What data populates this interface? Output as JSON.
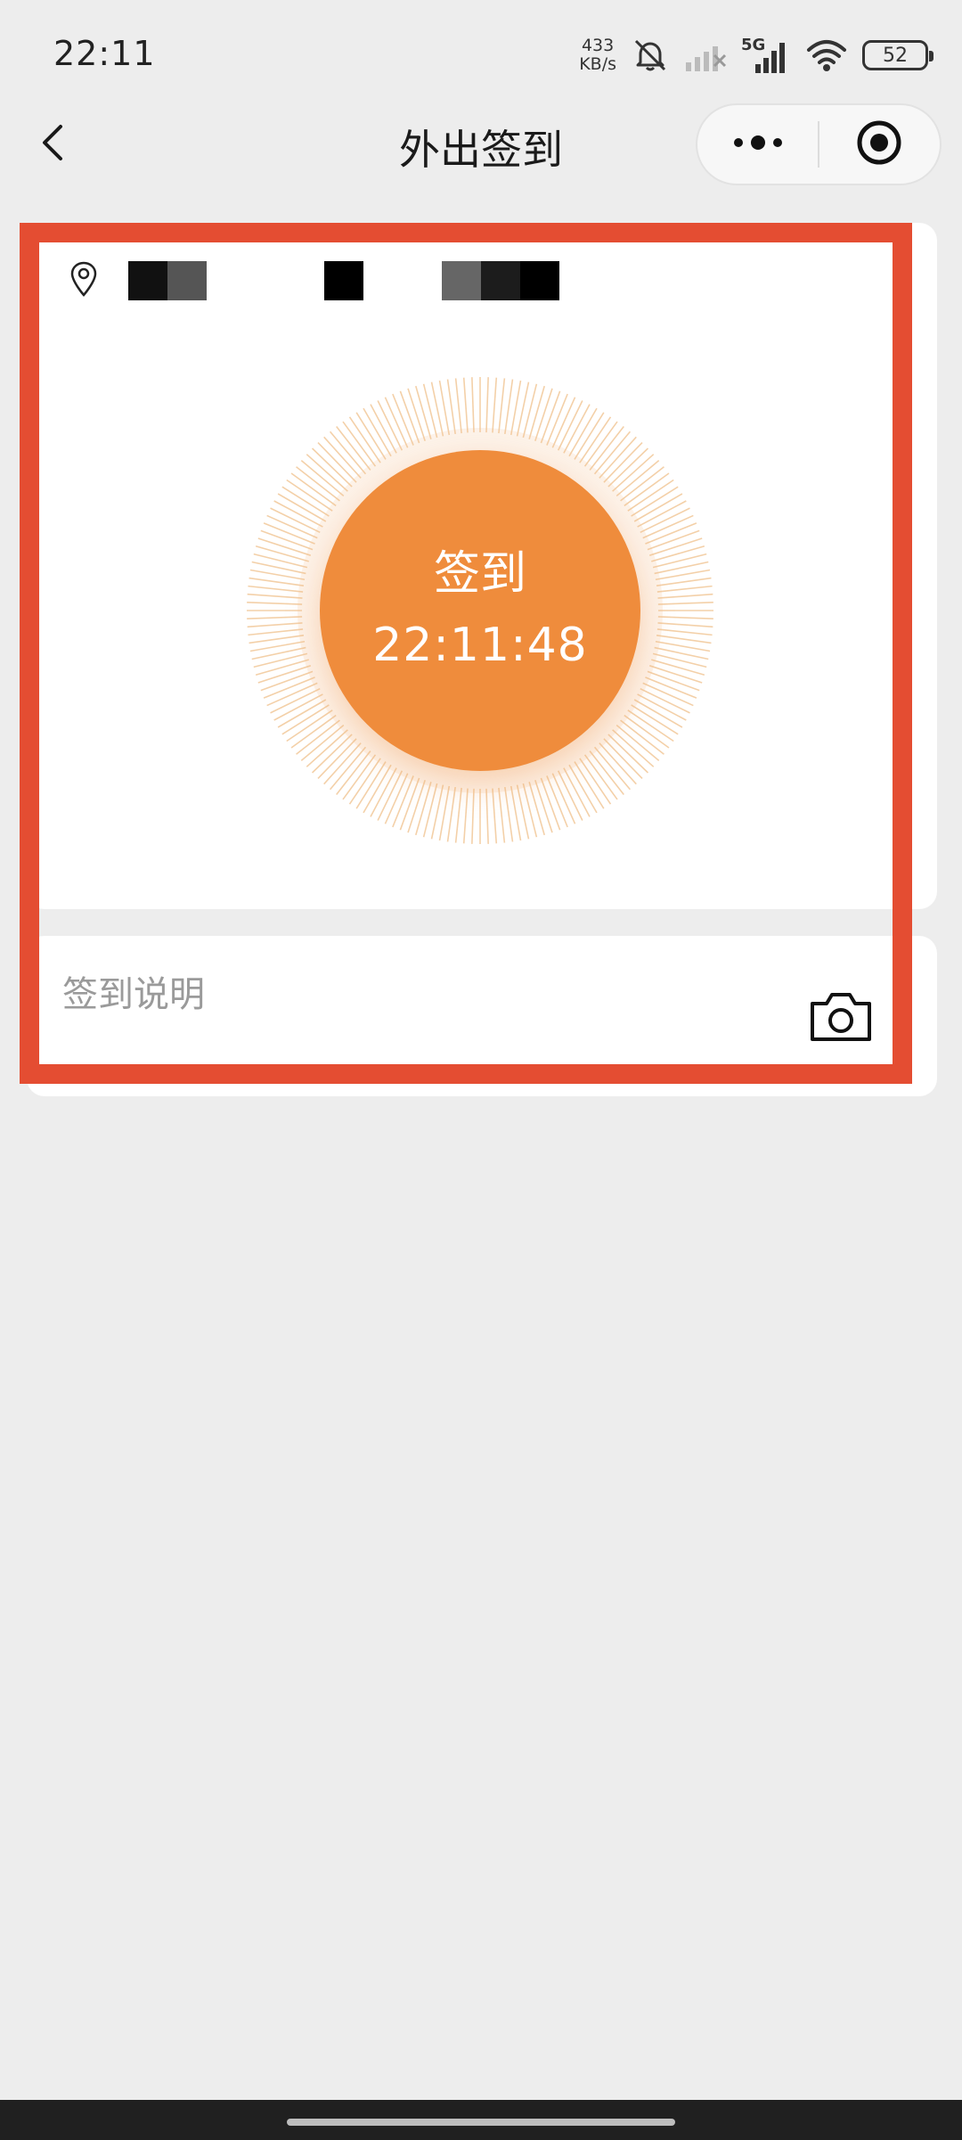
{
  "status_bar": {
    "time": "22:11",
    "net_speed_value": "433",
    "net_speed_unit": "KB/s",
    "network_label": "5G",
    "battery": "52",
    "icons": [
      "mute-bell-icon",
      "signal-weak-icon",
      "signal-5g-icon",
      "wifi-icon",
      "battery-icon"
    ]
  },
  "nav": {
    "title": "外出签到",
    "back_icon": "chevron-left-icon",
    "menu_icon": "more-dots-icon",
    "close_icon": "target-circle-icon"
  },
  "location": {
    "icon": "location-pin-icon",
    "redacted": true
  },
  "signin": {
    "label": "签到",
    "time": "22:11:48",
    "button_color": "#ef8c3c"
  },
  "remark": {
    "placeholder": "签到说明",
    "value": "",
    "camera_icon": "camera-icon"
  },
  "colors": {
    "highlight": "#e44d32",
    "background": "#ededed",
    "accent": "#ef8c3c"
  }
}
